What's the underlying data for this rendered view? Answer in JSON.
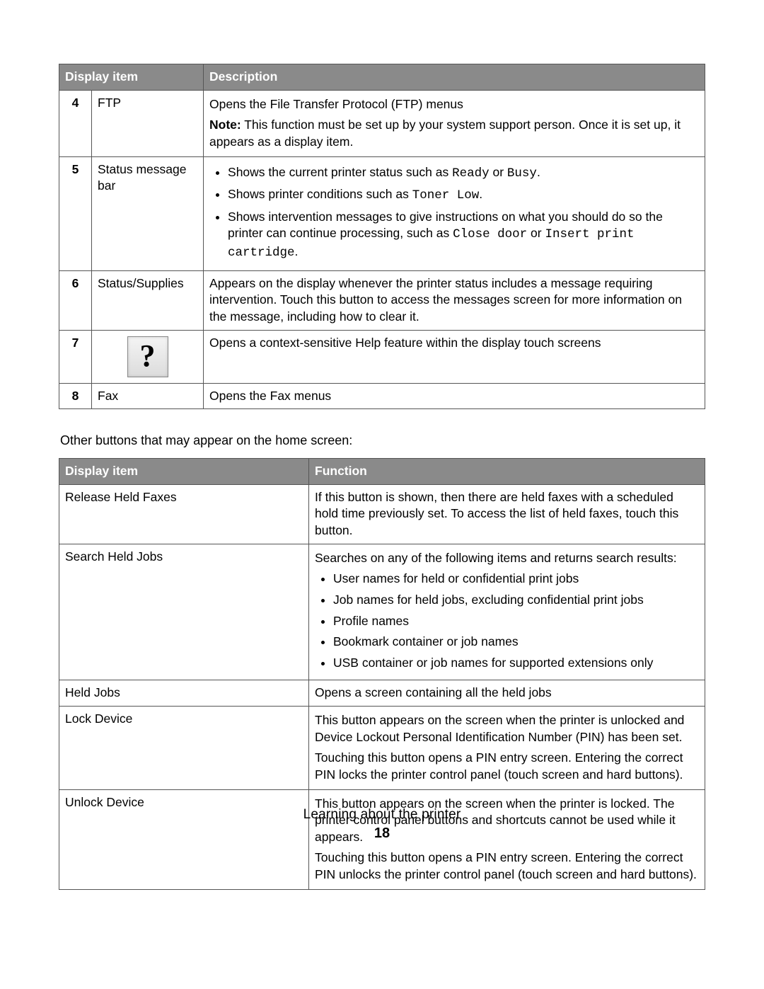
{
  "table1": {
    "headers": {
      "item": "Display item",
      "desc": "Description"
    },
    "rows": [
      {
        "num": "4",
        "item": "FTP",
        "desc_line1": "Opens the File Transfer Protocol (FTP) menus",
        "note_lead": "Note:",
        "note_rest": " This function must be set up by your system support person. Once it is set up, it appears as a display item."
      },
      {
        "num": "5",
        "item": "Status message bar",
        "bullets": [
          {
            "pre": "Shows the current printer status such as ",
            "mono1": "Ready",
            "mid": " or ",
            "mono2": "Busy",
            "post": "."
          },
          {
            "pre": "Shows printer conditions such as ",
            "mono1": "Toner Low",
            "mid": "",
            "mono2": "",
            "post": "."
          },
          {
            "pre": "Shows intervention messages to give instructions on what you should do so the printer can continue processing, such as ",
            "mono1": "Close door",
            "mid": " or ",
            "mono2": "Insert print cartridge",
            "post": "."
          }
        ]
      },
      {
        "num": "6",
        "item": "Status/Supplies",
        "desc": "Appears on the display whenever the printer status includes a message requiring intervention. Touch this button to access the messages screen for more information on the message, including how to clear it."
      },
      {
        "num": "7",
        "help_glyph": "?",
        "desc": "Opens a context-sensitive Help feature within the display touch screens"
      },
      {
        "num": "8",
        "item": "Fax",
        "desc": "Opens the Fax menus"
      }
    ]
  },
  "intro": "Other buttons that may appear on the home screen:",
  "table2": {
    "headers": {
      "item": "Display item",
      "func": "Function"
    },
    "rows": [
      {
        "item": "Release Held Faxes",
        "desc": "If this button is shown, then there are held faxes with a scheduled hold time previously set. To access the list of held faxes, touch this button."
      },
      {
        "item": "Search Held Jobs",
        "lead": "Searches on any of the following items and returns search results:",
        "bullets": [
          "User names for held or confidential print jobs",
          "Job names for held jobs, excluding confidential print jobs",
          "Profile names",
          "Bookmark container or job names",
          "USB container or job names for supported extensions only"
        ]
      },
      {
        "item": "Held Jobs",
        "desc": "Opens a screen containing all the held jobs"
      },
      {
        "item": "Lock Device",
        "p1": "This button appears on the screen when the printer is unlocked and Device Lockout Personal Identification Number (PIN) has been set.",
        "p2": "Touching this button opens a PIN entry screen. Entering the correct PIN locks the printer control panel (touch screen and hard buttons)."
      },
      {
        "item": "Unlock Device",
        "p1": "This button appears on the screen when the printer is locked. The printer control panel buttons and shortcuts cannot be used while it appears.",
        "p2": "Touching this button opens a PIN entry screen. Entering the correct PIN unlocks the printer control panel (touch screen and hard buttons)."
      }
    ]
  },
  "footer": {
    "section": "Learning about the printer",
    "page": "18"
  }
}
